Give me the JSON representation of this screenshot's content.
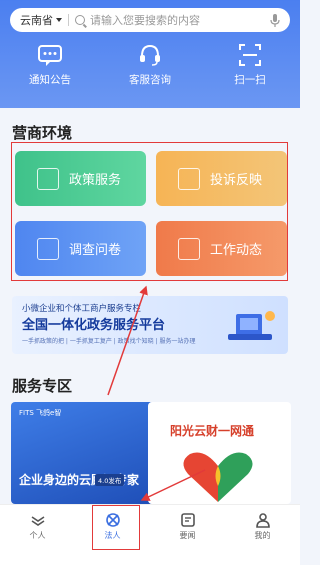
{
  "search": {
    "region": "云南省",
    "placeholder": "请输入您要搜索的内容"
  },
  "quick_actions": [
    {
      "label": "通知公告",
      "icon": "notice-icon"
    },
    {
      "label": "客服咨询",
      "icon": "headset-icon"
    },
    {
      "label": "扫一扫",
      "icon": "scan-icon"
    }
  ],
  "section1": {
    "title": "营商环境"
  },
  "tiles": [
    {
      "label": "政策服务",
      "icon": "policy-doc-icon"
    },
    {
      "label": "投诉反映",
      "icon": "complaint-icon"
    },
    {
      "label": "调查问卷",
      "icon": "survey-icon"
    },
    {
      "label": "工作动态",
      "icon": "trend-chart-icon"
    }
  ],
  "banner": {
    "line1": "小微企业和个体工商户服务专栏",
    "line2": "全国一体化政务服务平台",
    "line3": "一手抓政策的把 | 一手抓复工复产 | 政策找个知晓 | 服务一站办理"
  },
  "section2": {
    "title": "服务专区"
  },
  "service_cards": [
    {
      "logo": "FITS 飞鸽e智",
      "title": "企业身边的云顾问专家",
      "badge": "4.0发布"
    },
    {
      "title": "阳光云财一网通"
    }
  ],
  "nav": [
    {
      "label": "个人",
      "icon": "person-icon"
    },
    {
      "label": "法人",
      "icon": "legal-entity-icon",
      "active": true
    },
    {
      "label": "要闻",
      "icon": "news-icon"
    },
    {
      "label": "我的",
      "icon": "profile-icon"
    }
  ],
  "colors": {
    "primary": "#4b7ff0",
    "highlight": "#e23a3a"
  }
}
